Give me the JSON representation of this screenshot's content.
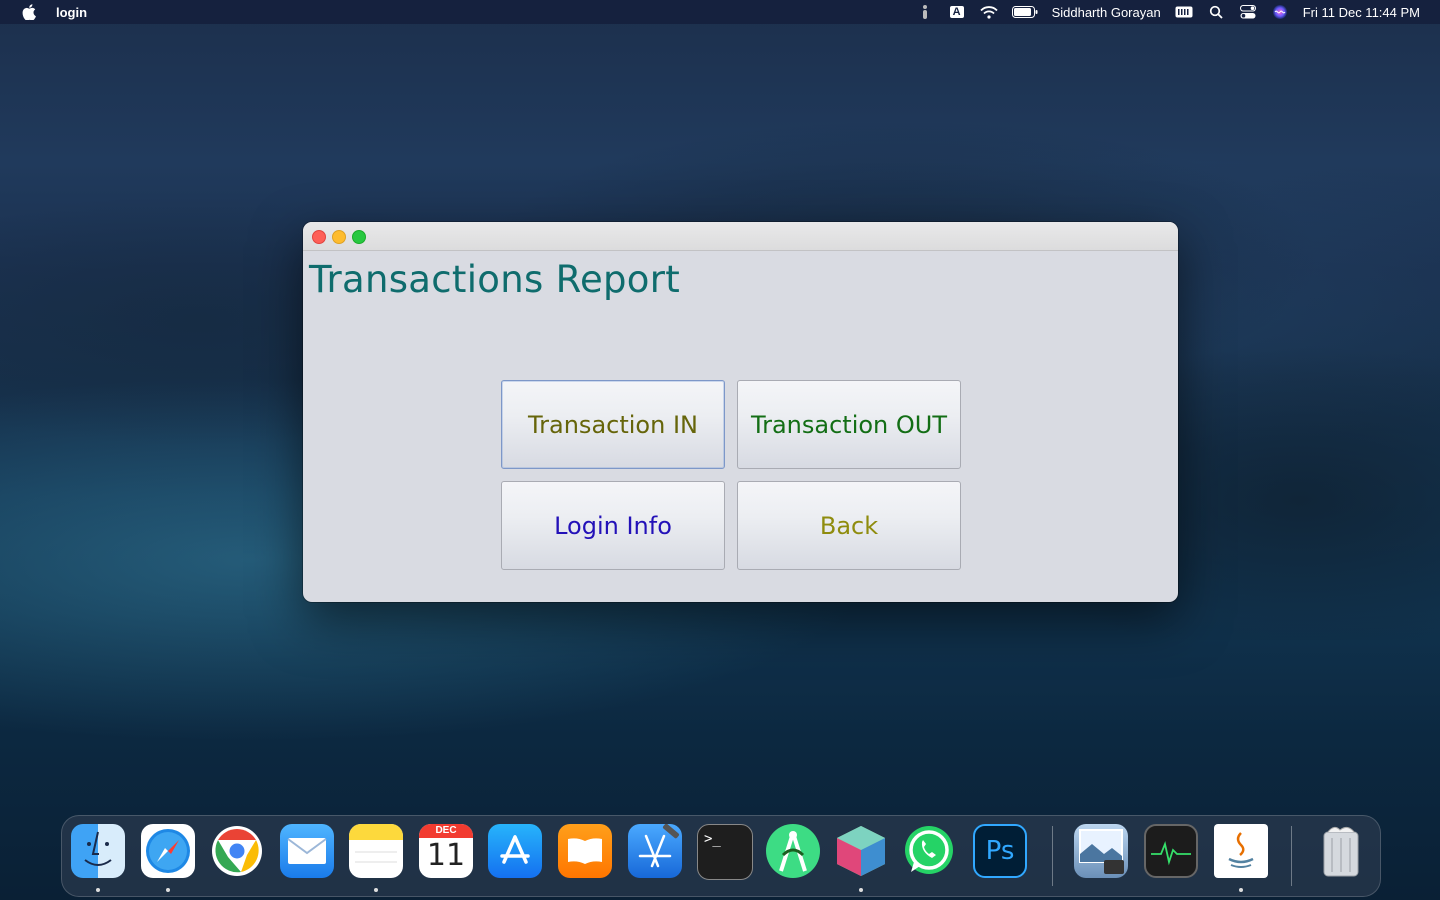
{
  "menubar": {
    "app_name": "login",
    "user_name": "Siddharth Gorayan",
    "datetime": "Fri 11 Dec  11:44 PM",
    "input_source": "A"
  },
  "window": {
    "title": "Transactions Report",
    "buttons": {
      "transaction_in": "Transaction IN",
      "transaction_out": "Transaction OUT",
      "login_info": "Login Info",
      "back": "Back"
    }
  },
  "dock": {
    "calendar_month": "DEC",
    "calendar_day": "11",
    "apps": [
      "finder",
      "safari",
      "chrome",
      "mail",
      "notes",
      "calendar",
      "app-store",
      "books",
      "xcode",
      "terminal",
      "android-studio",
      "netbeans",
      "whatsapp",
      "photoshop",
      "preview",
      "activity-monitor",
      "java",
      "trash"
    ]
  }
}
